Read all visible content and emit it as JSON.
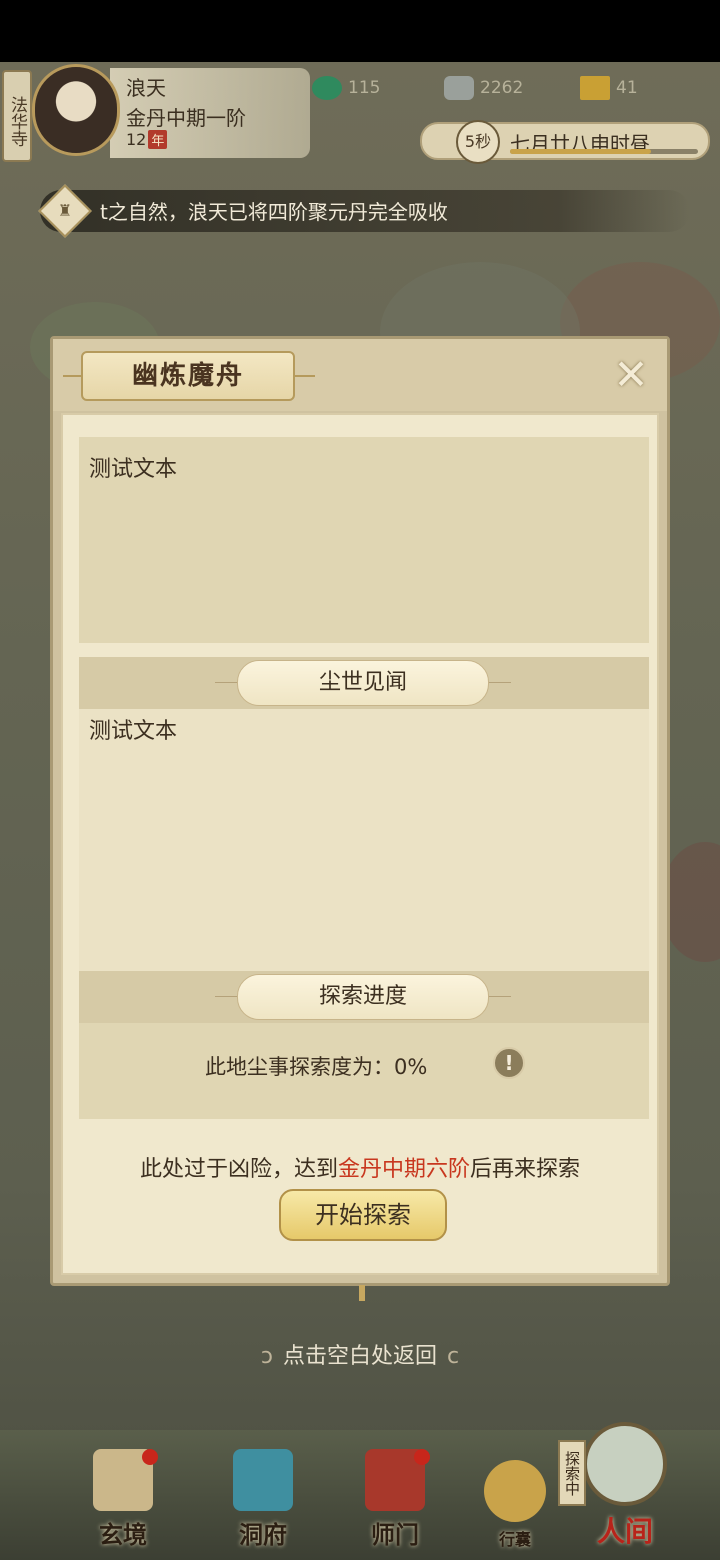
{
  "hud": {
    "sect": "法华寺",
    "player_name": "浪天",
    "realm": "金丹中期一阶",
    "age": "12",
    "age_unit": "年",
    "resources": [
      {
        "icon": "jade-icon",
        "value": "115"
      },
      {
        "icon": "coin-icon",
        "value": "2262"
      },
      {
        "icon": "merit-icon",
        "value": "41"
      }
    ],
    "countdown": "5秒",
    "date": "七月廿八申时昼"
  },
  "ticker": {
    "text": "t之自然，浪天已将四阶聚元丹完全吸收"
  },
  "dialog": {
    "title": "幽炼魔舟",
    "description": "测试文本",
    "events_header": "尘世见闻",
    "events_text": "测试文本",
    "progress_header": "探索进度",
    "progress_text": "此地尘事探索度为：0%",
    "progress_value": 0,
    "warning_prefix": "此处过于凶险，达到",
    "warning_realm": "金丹中期六阶",
    "warning_suffix": "后再来探索",
    "start_button": "开始探索"
  },
  "return_hint": "点击空白处返回",
  "bottom_nav": {
    "xuanjing": "玄境",
    "dongfu": "洞府",
    "shimen": "师门",
    "xingnang": "行囊",
    "renjian": "人间",
    "explore_tag": "探索中"
  },
  "colors": {
    "highlight_red": "#c8371f",
    "dialog_bg": "#f0e8cd",
    "button_gold": "#e6c96a"
  }
}
